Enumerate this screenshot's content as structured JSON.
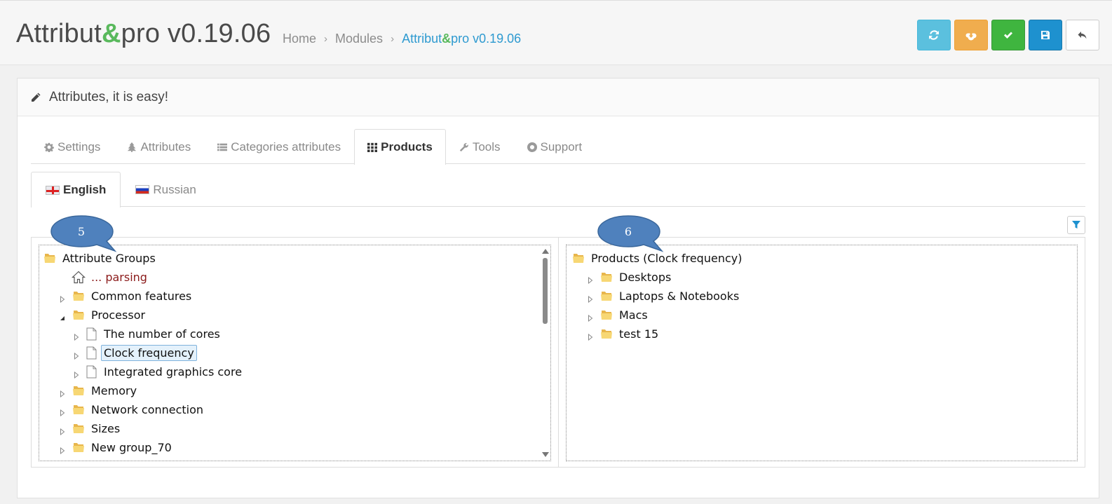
{
  "header": {
    "title_prefix": "Attribut",
    "title_amp": "&",
    "title_suffix": "pro v0.19.06",
    "breadcrumb": {
      "home": "Home",
      "modules": "Modules",
      "current_prefix": "Attribut",
      "current_amp": "&",
      "current_suffix": "pro v0.19.06",
      "separator": "›"
    },
    "toolbar": [
      "refresh-icon",
      "cloud-download-icon",
      "check-icon",
      "floppy-disk-icon",
      "reply-icon"
    ]
  },
  "panel": {
    "heading": "Attributes, it is easy!"
  },
  "tabs": [
    {
      "label": "Settings",
      "icon": "gear-icon"
    },
    {
      "label": "Attributes",
      "icon": "tree-icon"
    },
    {
      "label": "Categories attributes",
      "icon": "list-icon"
    },
    {
      "label": "Products",
      "icon": "grid-icon",
      "active": true
    },
    {
      "label": "Tools",
      "icon": "wrench-icon"
    },
    {
      "label": "Support",
      "icon": "life-ring-icon"
    }
  ],
  "languages": [
    {
      "label": "English",
      "active": true
    },
    {
      "label": "Russian"
    }
  ],
  "callouts": {
    "left": "5",
    "right": "6"
  },
  "left_tree": {
    "root": "Attribute Groups",
    "items": [
      {
        "label": "... parsing"
      },
      {
        "label": "Common features"
      },
      {
        "label": "Processor"
      },
      {
        "label": "The number of cores"
      },
      {
        "label": "Clock frequency"
      },
      {
        "label": "Integrated graphics core"
      },
      {
        "label": "Memory"
      },
      {
        "label": "Network connection"
      },
      {
        "label": "Sizes"
      },
      {
        "label": "New group_70"
      }
    ]
  },
  "right_tree": {
    "root": "Products (Clock frequency)",
    "items": [
      {
        "label": "Desktops"
      },
      {
        "label": "Laptops & Notebooks"
      },
      {
        "label": "Macs"
      },
      {
        "label": "test 15"
      }
    ]
  },
  "colors": {
    "accent_green": "#59b95c",
    "link_blue": "#2e9ad0",
    "callout_blue": "#4f81bd"
  }
}
